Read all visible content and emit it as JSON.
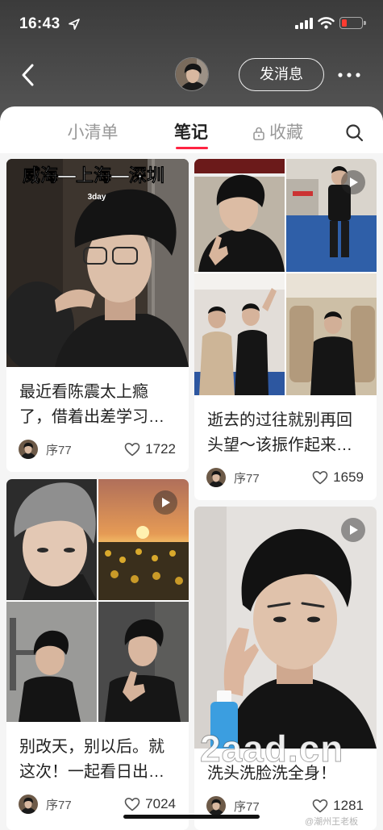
{
  "status_bar": {
    "time": "16:43",
    "icons": [
      "location-arrow-icon",
      "signal-icon",
      "wifi-icon",
      "battery-icon"
    ],
    "battery_color": "#ff3b30"
  },
  "header": {
    "back_icon": "chevron-left-icon",
    "avatar": "profile-avatar",
    "message_button_label": "发消息",
    "more_icon": "more-horizontal-icon"
  },
  "tabs": [
    {
      "label": "小清单",
      "active": false
    },
    {
      "label": "笔记",
      "active": true
    },
    {
      "label": "收藏",
      "active": false,
      "icon": "lock-icon"
    }
  ],
  "search_icon": "search-icon",
  "colors": {
    "accent": "#ff2442",
    "title_text": "#222222",
    "muted_text": "#999999"
  },
  "like_icon": "heart-outline-icon",
  "video_icon": "play-icon",
  "notes": [
    {
      "cover_overlay": {
        "title": "威海—上海—深圳",
        "subtitle": "3day"
      },
      "title_lines": [
        "最近看陈震太上瘾",
        "了，借着出差学习…"
      ],
      "author": "序77",
      "likes": "1722",
      "is_video": false
    },
    {
      "title_lines": [
        "逝去的过往就别再回",
        "头望～该振作起来…"
      ],
      "author": "序77",
      "likes": "1659",
      "is_video": true
    },
    {
      "title_lines": [
        "别改天，别以后。就",
        "这次！一起看日出…"
      ],
      "author": "序77",
      "likes": "7024",
      "is_video": true
    },
    {
      "title_lines": [
        "洗头洗脸洗全身！"
      ],
      "author": "序77",
      "likes": "1281",
      "is_video": true
    }
  ],
  "watermarks": {
    "site": "2aad.cn",
    "weibo": "@潮州王老板"
  }
}
